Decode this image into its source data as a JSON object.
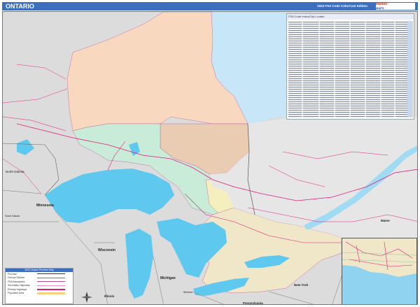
{
  "header": {
    "title": "ONTARIO",
    "edition": "2023 FSA Code ColorCast Edition",
    "logo_line1": "Market",
    "logo_line2": "MAPS"
  },
  "table": {
    "header": "FSA Code Index/City Locator"
  },
  "labels": {
    "north_dakota": "North Dakota",
    "minnesota": "Minnesota",
    "south_dakota": "South Dakota",
    "wisconsin": "Wisconsin",
    "michigan": "Michigan",
    "illinois": "Illinois",
    "new_york": "New York",
    "pennsylvania": "Pennsylvania",
    "maine": "Maine",
    "windsor": "Windsor"
  },
  "legend": {
    "title": "2023 Ontario Province Map",
    "rows": [
      "Province",
      "Census Division",
      "FSA Boundaries",
      "Secondary Highways",
      "Primary Highways",
      "Populated Area"
    ]
  },
  "colors": {
    "water": "#c7e6f8",
    "lake": "#5fc8ee",
    "land_outside": "#dcdcdc",
    "region_peach": "#f8d9bf",
    "region_tan": "#e9ccb2",
    "region_green": "#c9ecd9",
    "region_yellow": "#f5efc0",
    "highway": "#e2197b",
    "title_bar": "#3d6fbf"
  }
}
